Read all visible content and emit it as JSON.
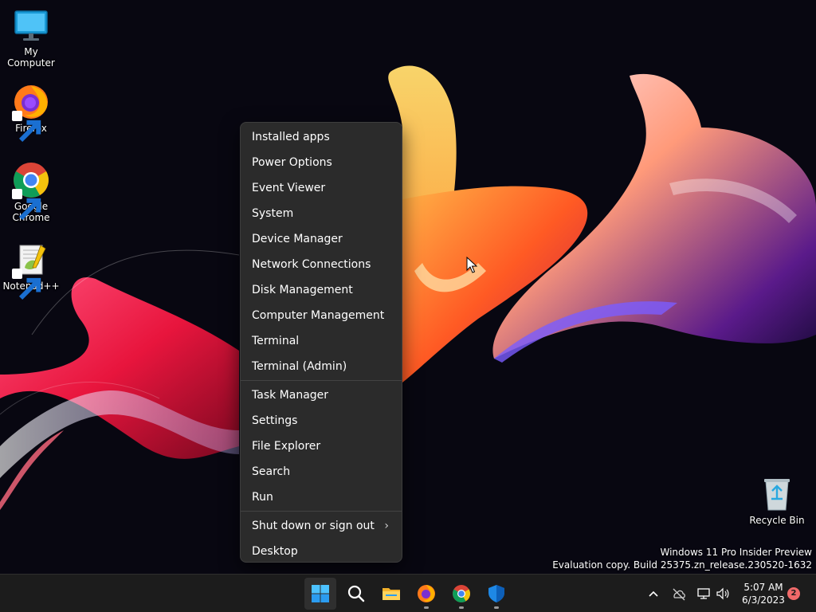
{
  "desktop_icons": [
    {
      "label": "My Computer",
      "icon": "monitor-icon",
      "shortcut": false
    },
    {
      "label": "Firefox",
      "icon": "firefox-icon",
      "shortcut": true
    },
    {
      "label": "Google Chrome",
      "icon": "chrome-icon",
      "shortcut": true
    },
    {
      "label": "Notepad++",
      "icon": "notepadpp-icon",
      "shortcut": true
    },
    {
      "label": "Recycle Bin",
      "icon": "recycle-bin-icon",
      "shortcut": false
    }
  ],
  "context_menu": {
    "group1": [
      {
        "label": "Installed apps"
      },
      {
        "label": "Power Options"
      },
      {
        "label": "Event Viewer"
      },
      {
        "label": "System"
      },
      {
        "label": "Device Manager"
      },
      {
        "label": "Network Connections"
      },
      {
        "label": "Disk Management"
      },
      {
        "label": "Computer Management"
      },
      {
        "label": "Terminal"
      },
      {
        "label": "Terminal (Admin)"
      }
    ],
    "group2": [
      {
        "label": "Task Manager"
      },
      {
        "label": "Settings"
      },
      {
        "label": "File Explorer"
      },
      {
        "label": "Search"
      },
      {
        "label": "Run"
      }
    ],
    "group3": [
      {
        "label": "Shut down or sign out",
        "submenu": true,
        "chevron": "›"
      },
      {
        "label": "Desktop"
      }
    ]
  },
  "watermark": {
    "line1": "Windows 11 Pro Insider Preview",
    "line2": "Evaluation copy. Build 25375.zn_release.230520-1632"
  },
  "taskbar": {
    "apps": [
      {
        "name": "start",
        "icon": "windows-logo-icon",
        "active": true
      },
      {
        "name": "search",
        "icon": "search-icon",
        "running": false
      },
      {
        "name": "file-explorer",
        "icon": "folder-icon",
        "running": false
      },
      {
        "name": "firefox",
        "icon": "firefox-icon",
        "running": true
      },
      {
        "name": "chrome",
        "icon": "chrome-icon",
        "running": true
      },
      {
        "name": "defender",
        "icon": "shield-icon",
        "running": true
      }
    ],
    "tray": {
      "overflow": "chevron-up-icon",
      "onedrive": "cloud-offline-icon",
      "network": "network-icon",
      "volume": "speaker-icon"
    },
    "clock": {
      "time": "5:07 AM",
      "date": "6/3/2023"
    },
    "notification_count": "2"
  },
  "colors": {
    "menu_bg": "#2b2b2b",
    "taskbar_bg": "#1c1c1c",
    "accent": "#0078d4",
    "badge": "#f06a6a"
  }
}
